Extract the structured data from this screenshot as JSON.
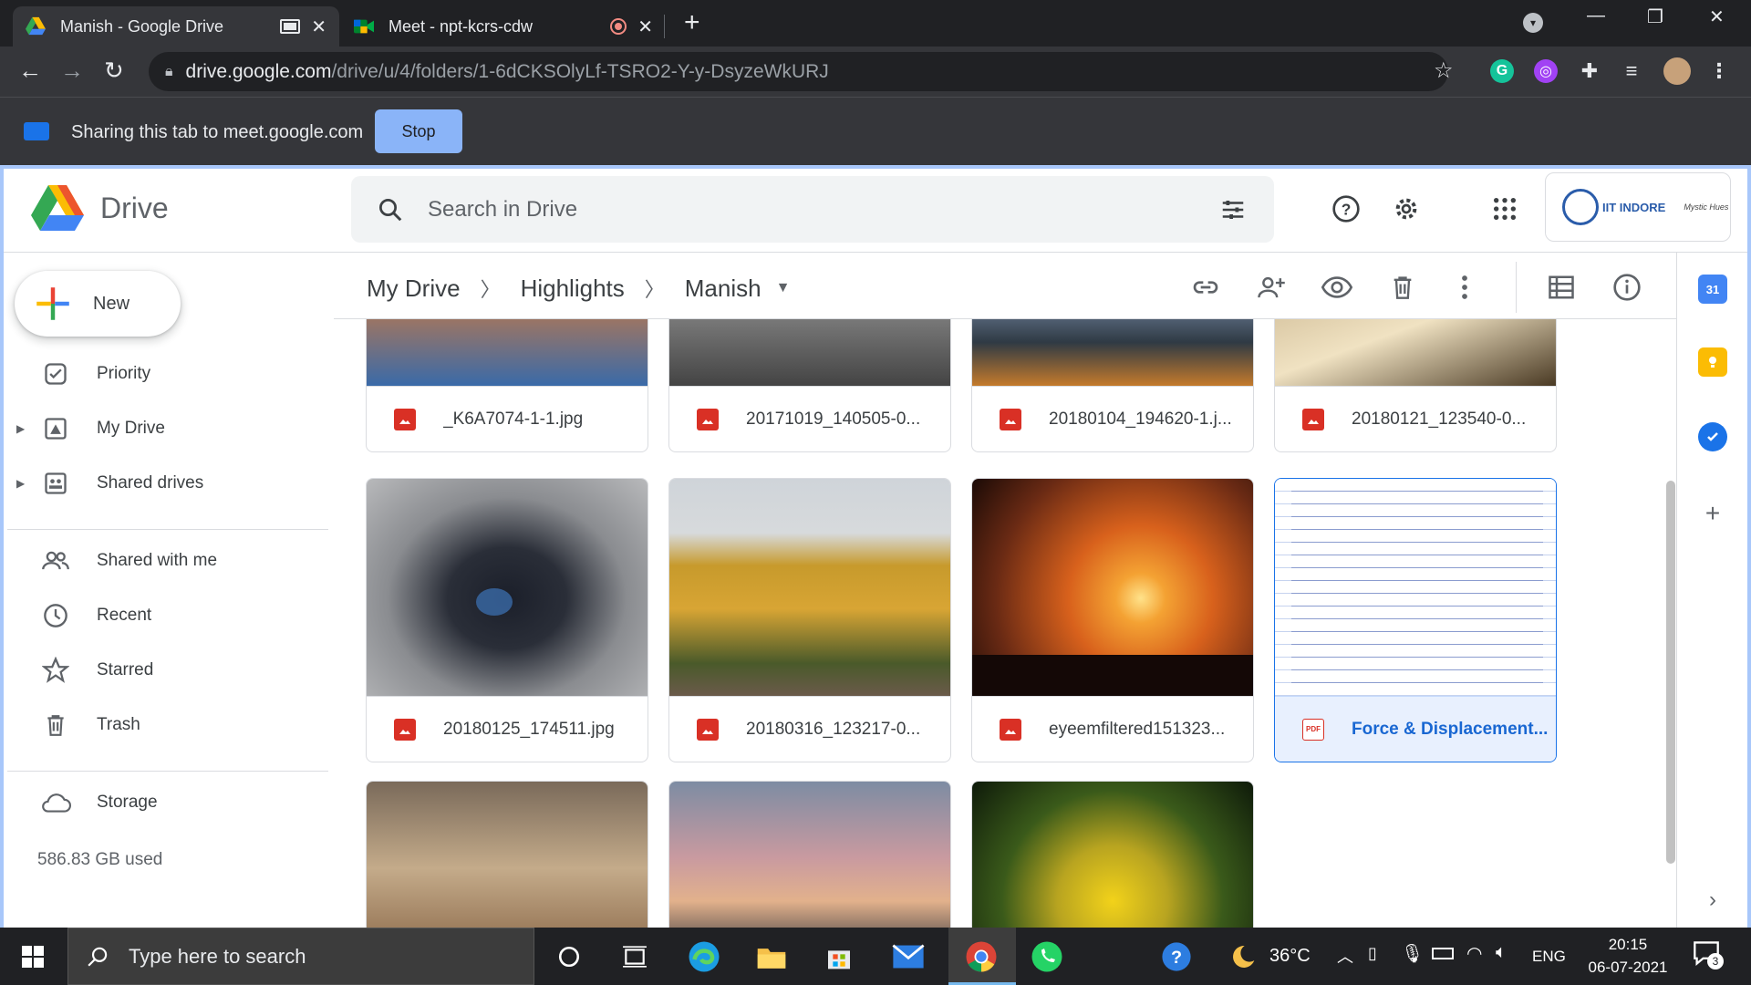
{
  "browser": {
    "tabs": [
      {
        "title": "Manish - Google Drive"
      },
      {
        "title": "Meet - npt-kcrs-cdw"
      }
    ],
    "url_host": "drive.google.com",
    "url_path": "/drive/u/4/folders/1-6dCKSOlyLf-TSRO2-Y-y-DsyzeWkURJ"
  },
  "share_banner": {
    "text": "Sharing this tab to meet.google.com",
    "stop_label": "Stop"
  },
  "drive": {
    "app_name": "Drive",
    "search_placeholder": "Search in Drive",
    "account_org": "IIT INDORE",
    "account_mini": "Mystic Hues",
    "new_label": "New",
    "nav": [
      {
        "label": "Priority",
        "icon": "priority-icon"
      },
      {
        "label": "My Drive",
        "icon": "my-drive-icon"
      },
      {
        "label": "Shared drives",
        "icon": "shared-drives-icon"
      },
      {
        "label": "Shared with me",
        "icon": "people-icon"
      },
      {
        "label": "Recent",
        "icon": "clock-icon"
      },
      {
        "label": "Starred",
        "icon": "star-icon"
      },
      {
        "label": "Trash",
        "icon": "trash-icon"
      },
      {
        "label": "Storage",
        "icon": "cloud-icon"
      }
    ],
    "storage_used": "586.83 GB used",
    "breadcrumb": [
      "My Drive",
      "Highlights",
      "Manish"
    ],
    "files": [
      {
        "name": "_K6A7074-1-1.jpg",
        "type": "image"
      },
      {
        "name": "20171019_140505-0...",
        "type": "image"
      },
      {
        "name": "20180104_194620-1.j...",
        "type": "image"
      },
      {
        "name": "20180121_123540-0...",
        "type": "image"
      },
      {
        "name": "20180125_174511.jpg",
        "type": "image"
      },
      {
        "name": "20180316_123217-0...",
        "type": "image"
      },
      {
        "name": "eyeemfiltered151323...",
        "type": "image"
      },
      {
        "name": "Force & Displacement...",
        "type": "pdf",
        "selected": true
      },
      {
        "name": "",
        "type": "image"
      },
      {
        "name": "",
        "type": "image"
      },
      {
        "name": "",
        "type": "image"
      }
    ]
  },
  "taskbar": {
    "search_placeholder": "Type here to search",
    "weather": "36°C",
    "lang": "ENG",
    "time": "20:15",
    "date": "06-07-2021",
    "notif_count": "3"
  },
  "colors": {
    "accent": "#1a73e8",
    "share_stop": "#8ab4f8",
    "selected_bg": "#e8f0fe"
  }
}
